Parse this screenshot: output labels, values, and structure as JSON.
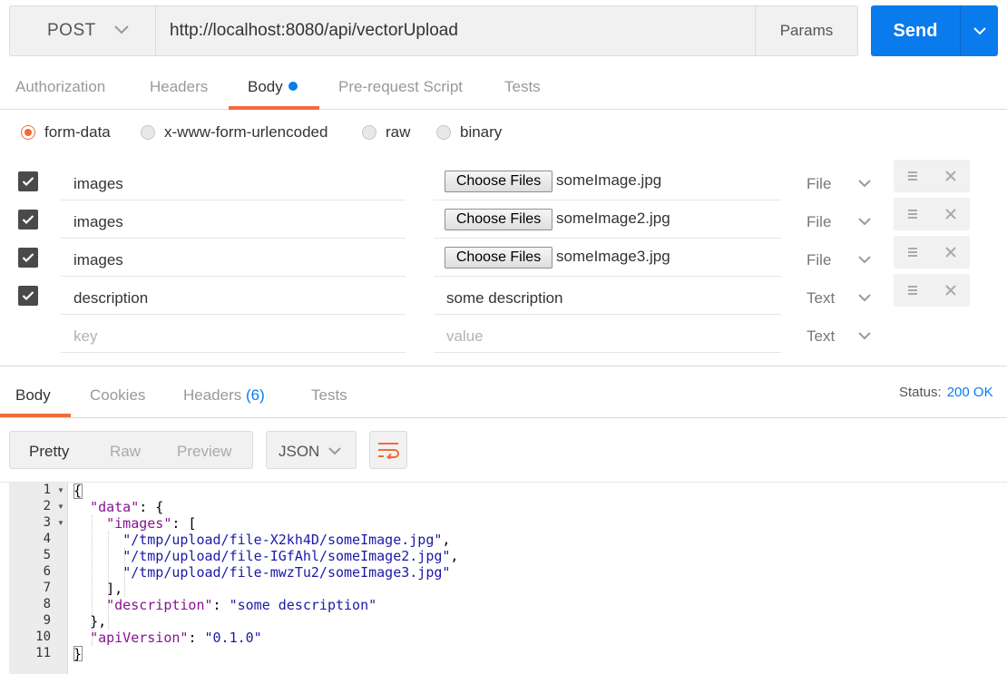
{
  "request": {
    "method": "POST",
    "url": "http://localhost:8080/api/vectorUpload",
    "params_label": "Params",
    "send_label": "Send"
  },
  "request_tabs": [
    "Authorization",
    "Headers",
    "Body",
    "Pre-request Script",
    "Tests"
  ],
  "active_request_tab": "Body",
  "body_types": [
    "form-data",
    "x-www-form-urlencoded",
    "raw",
    "binary"
  ],
  "selected_body_type": "form-data",
  "form_rows": [
    {
      "checked": true,
      "key": "images",
      "button": "Choose Files",
      "value": "someImage.jpg",
      "type": "File"
    },
    {
      "checked": true,
      "key": "images",
      "button": "Choose Files",
      "value": "someImage2.jpg",
      "type": "File"
    },
    {
      "checked": true,
      "key": "images",
      "button": "Choose Files",
      "value": "someImage3.jpg",
      "type": "File"
    },
    {
      "checked": true,
      "key": "description",
      "value": "some description",
      "type": "Text"
    }
  ],
  "new_row": {
    "key_placeholder": "key",
    "value_placeholder": "value",
    "type": "Text"
  },
  "response_tabs": {
    "body": "Body",
    "cookies": "Cookies",
    "headers": "Headers",
    "headers_count": "(6)",
    "tests": "Tests"
  },
  "status": {
    "label": "Status:",
    "value": "200 OK"
  },
  "view_modes": [
    "Pretty",
    "Raw",
    "Preview"
  ],
  "active_view_mode": "Pretty",
  "format": "JSON",
  "line_numbers": [
    "1",
    "2",
    "3",
    "4",
    "5",
    "6",
    "7",
    "8",
    "9",
    "10",
    "11"
  ],
  "response_json": {
    "open_brace": "{",
    "data_key": "\"data\"",
    "images_key": "\"images\"",
    "image_paths": [
      "\"/tmp/upload/file-X2kh4D/someImage.jpg\"",
      "\"/tmp/upload/file-IGfAhl/someImage2.jpg\"",
      "\"/tmp/upload/file-mwzTu2/someImage3.jpg\""
    ],
    "description_key": "\"description\"",
    "description_value": "\"some description\"",
    "api_version_key": "\"apiVersion\"",
    "api_version_value": "\"0.1.0\"",
    "close_brace": "}"
  },
  "colors": {
    "accent_blue": "#097bed",
    "tab_underline_orange": "#f26b3a",
    "json_key": "#881391",
    "json_string": "#1a1aa6"
  },
  "icons": [
    "chevron-down-icon",
    "check-icon",
    "menu-icon",
    "close-icon",
    "wrap-lines-icon"
  ]
}
